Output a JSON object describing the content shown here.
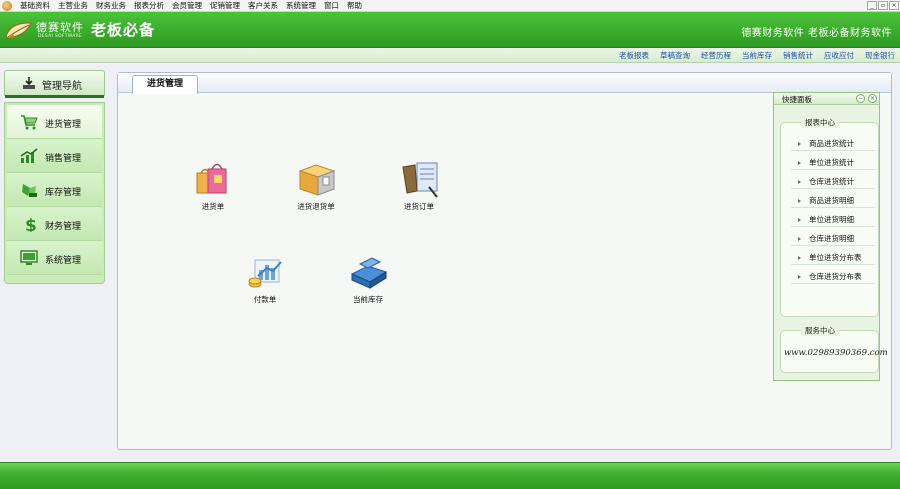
{
  "menu": [
    "基础资料",
    "主营业务",
    "财务业务",
    "报表分析",
    "会员管理",
    "促销管理",
    "客户关系",
    "系统管理",
    "窗口",
    "帮助"
  ],
  "window_controls": [
    "_",
    "▫",
    "×"
  ],
  "banner": {
    "logo_name": "德赛软件",
    "logo_sub": "DESAI SOFTWARE",
    "title": "老板必备",
    "right_text": "德赛财务软件  老板必备财务软件"
  },
  "quick_links": [
    "老板报表",
    "草稿查询",
    "经营历程",
    "当前库存",
    "销售统计",
    "应收应付",
    "现金银行"
  ],
  "nav": {
    "header": "管理导航",
    "items": [
      {
        "label": "进货管理",
        "icon": "cart-icon",
        "active": true
      },
      {
        "label": "销售管理",
        "icon": "trend-chart-icon",
        "active": false
      },
      {
        "label": "库存管理",
        "icon": "inventory-icon",
        "active": false
      },
      {
        "label": "财务管理",
        "icon": "dollar-icon",
        "active": false
      },
      {
        "label": "系统管理",
        "icon": "monitor-icon",
        "active": false
      }
    ]
  },
  "main": {
    "tab": "进货管理",
    "functions": [
      {
        "label": "进货单",
        "icon": "shopping-bags-icon"
      },
      {
        "label": "进货退货单",
        "icon": "return-box-icon"
      },
      {
        "label": "进货订单",
        "icon": "order-form-icon"
      },
      {
        "label": "付款单",
        "icon": "payment-chart-icon"
      },
      {
        "label": "当前库存",
        "icon": "stock-boxes-icon"
      }
    ]
  },
  "quick_panel": {
    "title": "快捷面板",
    "report_center": {
      "title": "报表中心",
      "items": [
        "商品进货统计",
        "单位进货统计",
        "仓库进货统计",
        "商品进货明细",
        "单位进货明细",
        "仓库进货明细",
        "单位进货分布表",
        "仓库进货分布表"
      ]
    },
    "service_center": {
      "title": "服务中心",
      "phone": "www.02989390369.com"
    }
  },
  "colors": {
    "brand_green": "#2d9a21",
    "link_blue": "#1c4fa0",
    "panel_border": "#a9bfdb"
  }
}
